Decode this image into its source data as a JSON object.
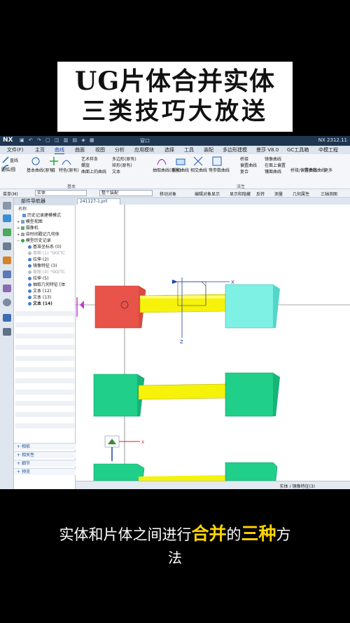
{
  "banner": {
    "line1": "UG片体合并实体",
    "line2": "三类技巧大放送"
  },
  "titlebar": {
    "logo": "NX",
    "version": "NX 2312.11",
    "window_menu": "窗口"
  },
  "menubar": [
    "文件(F)",
    "主页",
    "曲线",
    "曲面",
    "视图",
    "分析",
    "应用模块",
    "选择",
    "工具",
    "装配",
    "多边形建模",
    "曼莎 V8.0",
    "GC工具箱",
    "中模工程"
  ],
  "menubar_active": "曲线",
  "ribbon": {
    "items": [
      "直线",
      "圆弧/圆",
      "基本曲线(原有)",
      "点",
      "特色(原有)",
      "艺术样条",
      "螺旋",
      "曲面上的曲线",
      "多边形(原有)",
      "矩形(原有)",
      "文本",
      "抽取曲线(原有)",
      "投影曲线",
      "相交曲线",
      "等参数曲线",
      "桥接",
      "偏置曲线",
      "复合",
      "镜像曲线",
      "在面上偏置",
      "镶面曲线",
      "桥接/偏置曲线",
      "等参数曲线",
      "更多"
    ],
    "groups": [
      "基本",
      "派生"
    ]
  },
  "toolbar2": {
    "menu": "菜单(M)",
    "filter": "实体",
    "assembly": "整个装配",
    "items": [
      "移动对象",
      "编辑对象显示",
      "显示和隐藏",
      "反转",
      "测量",
      "几何属性",
      "三轴测图"
    ]
  },
  "navigator": {
    "title": "部件导航器",
    "col_header": "名称",
    "rows": [
      {
        "label": "历史记录建模模式",
        "kind": "mode"
      },
      {
        "label": "模型视图",
        "kind": "folder"
      },
      {
        "label": "摄像机",
        "kind": "folder"
      },
      {
        "label": "自时间戳记几何体",
        "kind": "folder"
      },
      {
        "label": "模型历史记录",
        "kind": "folder"
      },
      {
        "label": "基准坐标系 (0)",
        "kind": "feature"
      },
      {
        "label": "草图 (1) \"SKETC",
        "kind": "dim"
      },
      {
        "label": "拉伸 (2)",
        "kind": "feature"
      },
      {
        "label": "镜像特征 (3)",
        "kind": "feature"
      },
      {
        "label": "草图 (4) \"SKETC",
        "kind": "dim"
      },
      {
        "label": "拉伸 (5)",
        "kind": "feature"
      },
      {
        "label": "抽取几何特征 [体",
        "kind": "feature"
      },
      {
        "label": "文本 (12)",
        "kind": "feature"
      },
      {
        "label": "文本 (13)",
        "kind": "feature"
      },
      {
        "label": "文本 (14)",
        "kind": "bold"
      }
    ],
    "accordions": [
      "相依",
      "相关性",
      "细节",
      "预览"
    ]
  },
  "viewport": {
    "tab": "241127-1.prt",
    "axis_x": "X",
    "axis_z": "Z"
  },
  "status": "实体 / 镜像特征(3)",
  "caption": {
    "pre": "实体和片体之间进行",
    "hl1": "合并",
    "mid": "的",
    "hl2": "三种",
    "post": "方",
    "line2": "法"
  },
  "colors": {
    "red_block": "#e8544a",
    "cyan_block": "#7ef0e4",
    "green_block": "#1fcf8a",
    "yellow_rod": "#f6f20a",
    "highlight": "#ffd400"
  }
}
